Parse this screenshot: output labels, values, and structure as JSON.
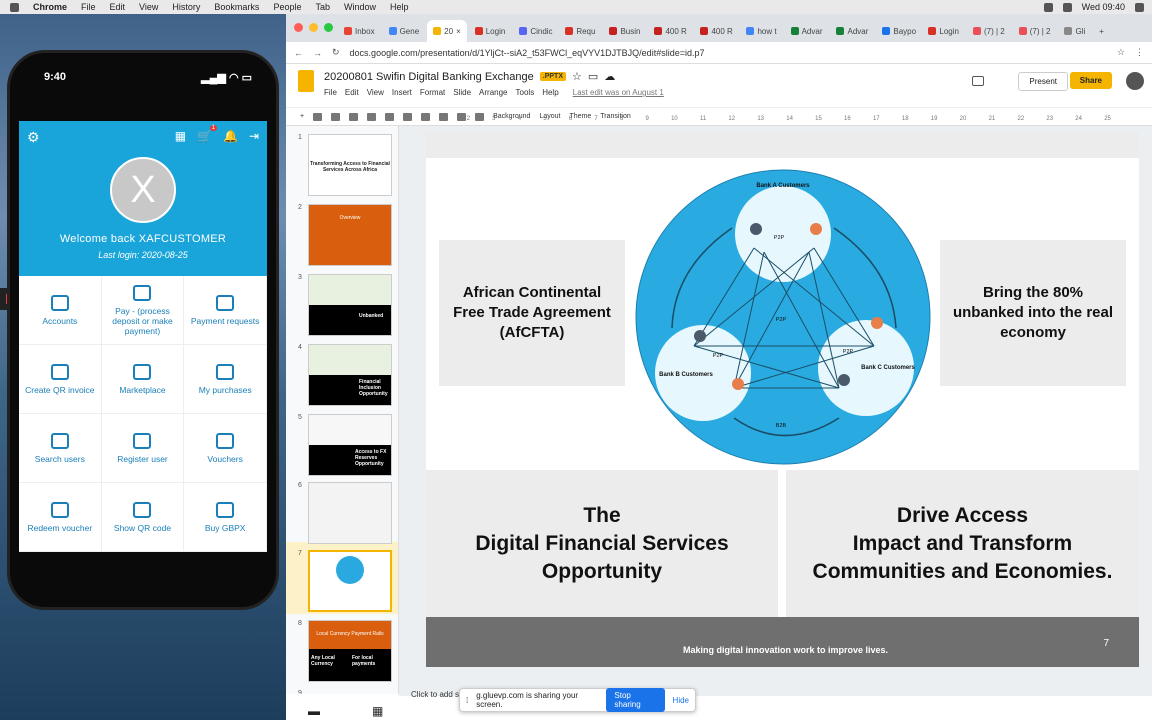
{
  "menubar": {
    "app": "Chrome",
    "items": [
      "File",
      "Edit",
      "View",
      "History",
      "Bookmarks",
      "People",
      "Tab",
      "Window",
      "Help"
    ],
    "clock": "Wed 09:40"
  },
  "phone": {
    "time": "9:40",
    "cart_badge": "1",
    "welcome": "Welcome back XAFCUSTOMER",
    "last_login": "Last login: 2020-08-25",
    "avatar_letter": "X",
    "tiles": [
      "Accounts",
      "Pay - (process deposit or make payment)",
      "Payment requests",
      "Create QR invoice",
      "Marketplace",
      "My purchases",
      "Search users",
      "Register user",
      "Vouchers",
      "Redeem voucher",
      "Show QR code",
      "Buy GBPX"
    ]
  },
  "browser": {
    "tabs": [
      "Inbox",
      "Gene",
      "20",
      "Login",
      "Cindic",
      "Requ",
      "Busin",
      "400 R",
      "400 R",
      "how t",
      "Advar",
      "Advar",
      "Baypo",
      "Login",
      "(7) | 2",
      "(7) | 2",
      "Gli"
    ],
    "url": "docs.google.com/presentation/d/1YljCt--siA2_t53FWCl_eqVYV1DJTBJQ/edit#slide=id.p7"
  },
  "docs": {
    "title": "20200801 Swifin Digital Banking Exchange",
    "badge": ".PPTX",
    "menu": [
      "File",
      "Edit",
      "View",
      "Insert",
      "Format",
      "Slide",
      "Arrange",
      "Tools",
      "Help"
    ],
    "last_edit": "Last edit was on August 1",
    "present": "Present",
    "share": "Share",
    "toolbar": [
      "Background",
      "Layout",
      "Theme",
      "Transition"
    ],
    "notes_hint": "Click to add s"
  },
  "ruler": [
    "1",
    "2",
    "3",
    "4",
    "5",
    "6",
    "7",
    "8",
    "9",
    "10",
    "11",
    "12",
    "13",
    "14",
    "15",
    "16",
    "17",
    "18",
    "19",
    "20",
    "21",
    "22",
    "23",
    "24",
    "25"
  ],
  "filmstrip": {
    "slide_numbers": [
      "1",
      "2",
      "3",
      "4",
      "5",
      "6",
      "7",
      "8",
      "9"
    ],
    "t1": "Transforming Access to Financial Services Across Africa",
    "t2": "Overview",
    "t3": "Unbanked",
    "t4": "Financial Inclusion Opportunity",
    "t5": "Access to FX Reserves Opportunity",
    "t8": "Local Currency Payment Rails",
    "t8a": "Any Local Currency",
    "t8b": "For local payments"
  },
  "slide": {
    "left_box": "African Continental Free Trade Agreement (AfCFTA)",
    "right_box": "Bring the 80% unbanked into the real economy",
    "bottom_left": "The\nDigital Financial Services\nOpportunity",
    "bottom_right": "Drive Access\nImpact and Transform\nCommunities and Economies.",
    "footer": "Making digital innovation work to improve lives.",
    "page": "7",
    "bank_a": "Bank A Customers",
    "bank_b": "Bank B Customers",
    "bank_c": "Bank C Customers",
    "p2p": "P2P",
    "b2b": "B2B"
  },
  "sharebar": {
    "text": "g.gluevp.com is sharing your screen.",
    "stop": "Stop sharing",
    "hide": "Hide"
  }
}
